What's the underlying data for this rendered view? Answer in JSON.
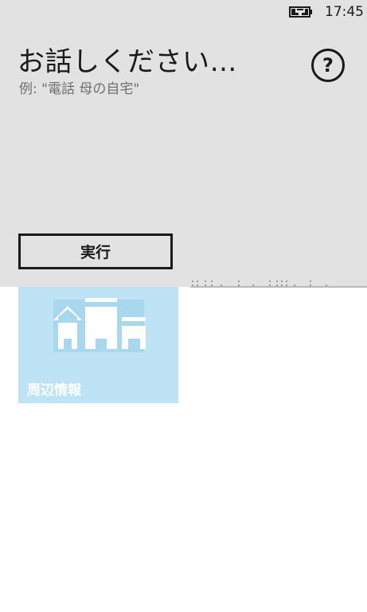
{
  "status_bar": {
    "time": "17:45",
    "battery_icon": "battery-charging-icon"
  },
  "speech": {
    "prompt": "お話しください…",
    "example": "例: \"電話 母の自宅\"",
    "help_label": "?",
    "help_icon": "help-circle-icon",
    "execute_label": "実行"
  },
  "tiles": [
    {
      "label": "周辺情報",
      "icon": "buildings-icon",
      "color": "#bde3f5"
    }
  ],
  "colors": {
    "panel": "#e2e2e2",
    "tile": "#bde3f5",
    "text": "#1a1a1a"
  }
}
